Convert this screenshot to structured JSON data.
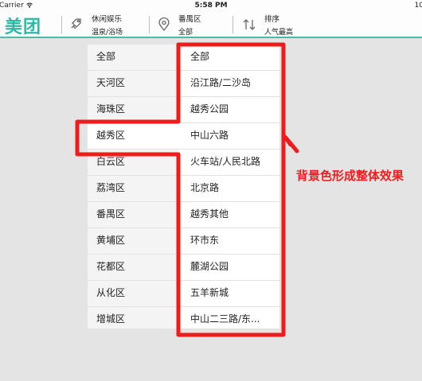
{
  "status_bar": {
    "carrier": "Carrier",
    "time": "5:58 PM",
    "battery": "10"
  },
  "nav": {
    "logo": "美团",
    "category": {
      "title": "休闲娱乐",
      "subtitle": "温泉/浴场"
    },
    "region": {
      "title": "番禺区",
      "subtitle": "全部"
    },
    "sort": {
      "title": "排序",
      "subtitle": "人气最高"
    }
  },
  "districts": [
    "全部",
    "天河区",
    "海珠区",
    "越秀区",
    "白云区",
    "荔湾区",
    "番禺区",
    "黄埔区",
    "花都区",
    "从化区",
    "增城区"
  ],
  "selected_district": "越秀区",
  "areas": [
    "全部",
    "沿江路/二沙岛",
    "越秀公园",
    "中山六路",
    "火车站/人民北路",
    "北京路",
    "越秀其他",
    "环市东",
    "麓湖公园",
    "五羊新城",
    "中山二三路/东..."
  ],
  "annotation": {
    "text": "背景色形成整体效果",
    "color": "#ee1c1c"
  }
}
